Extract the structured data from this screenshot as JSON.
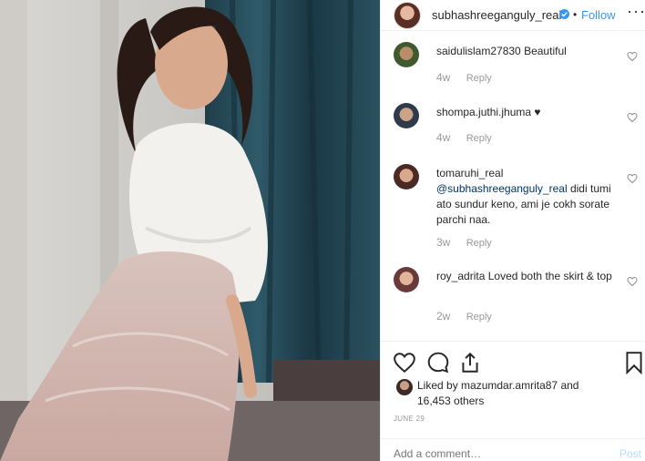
{
  "header": {
    "username": "subhashreeganguly_real",
    "separator": "•",
    "follow_label": "Follow",
    "more_label": "···"
  },
  "comments": [
    {
      "user": "saidulislam27830",
      "text": "Beautiful",
      "time": "4w",
      "reply": "Reply"
    },
    {
      "user": "shompa.juthi.jhuma",
      "text": "♥",
      "time": "4w",
      "reply": "Reply"
    },
    {
      "user": "tomaruhi_real",
      "mention": "@subhashreeganguly_real",
      "text": "didi tumi ato sundur keno, ami je cokh sorate parchi naa.",
      "time": "3w",
      "reply": "Reply"
    },
    {
      "user": "roy_adrita",
      "text": "Loved both the skirt & top",
      "time": "2w",
      "reply": "Reply"
    }
  ],
  "likes": {
    "prefix": "Liked by",
    "user": "mazumdar.amrita87",
    "and": "and",
    "count": "16,453 others"
  },
  "date": "JUNE 29",
  "add_comment": {
    "placeholder": "Add a comment…",
    "post_label": "Post"
  },
  "icons": {
    "like": "heart-icon",
    "comment": "comment-icon",
    "share": "share-icon",
    "save": "bookmark-icon"
  },
  "colors": {
    "link": "#3897f0",
    "mention": "#003569",
    "muted": "#999999",
    "post_disabled": "#b2dffc"
  }
}
